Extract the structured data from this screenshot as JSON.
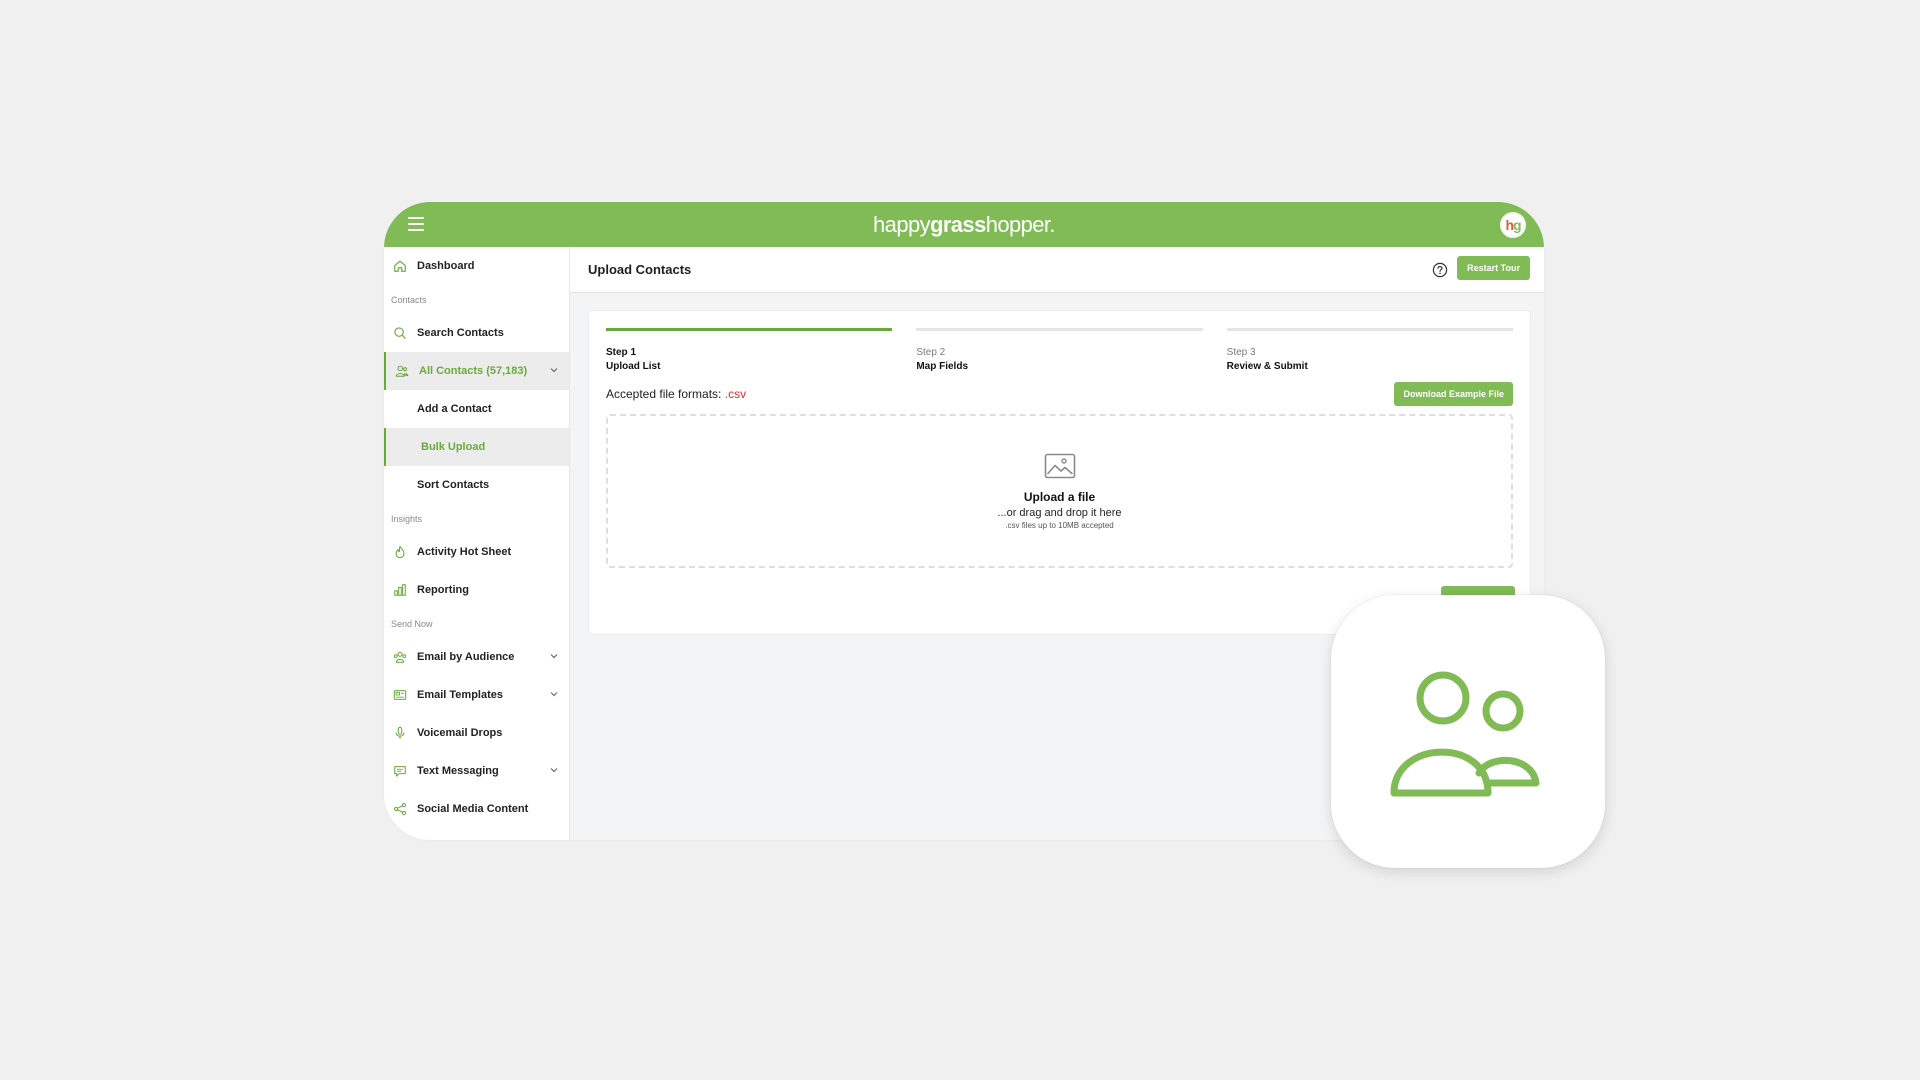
{
  "header": {
    "logo_prefix": "happy",
    "logo_bold": "grass",
    "logo_suffix": "hopper",
    "logo_mark": ".",
    "avatar_h": "h",
    "avatar_g": "g"
  },
  "sidebar": {
    "dashboard": "Dashboard",
    "section_contacts": "Contacts",
    "search_contacts": "Search Contacts",
    "all_contacts": "All Contacts (57,183)",
    "add_contact": "Add a Contact",
    "bulk_upload": "Bulk Upload",
    "sort_contacts": "Sort Contacts",
    "section_insights": "Insights",
    "activity_hot_sheet": "Activity Hot Sheet",
    "reporting": "Reporting",
    "section_send_now": "Send Now",
    "email_by_audience": "Email by Audience",
    "email_templates": "Email Templates",
    "voicemail_drops": "Voicemail Drops",
    "text_messaging": "Text Messaging",
    "social_media_content": "Social Media Content"
  },
  "page": {
    "title": "Upload Contacts",
    "restart_tour": "Restart Tour"
  },
  "steps": [
    {
      "num": "Step 1",
      "label": "Upload List"
    },
    {
      "num": "Step 2",
      "label": "Map Fields"
    },
    {
      "num": "Step 3",
      "label": "Review & Submit"
    }
  ],
  "upload": {
    "formats_label": "Accepted file formats:",
    "formats_ext": ".csv",
    "download_example": "Download Example File",
    "title": "Upload a file",
    "drag_text": "...or drag and drop it here",
    "hint": ".csv files up to 10MB accepted"
  },
  "colors": {
    "brand_green": "#81bb56",
    "active_green": "#6aaa3c",
    "csv_red": "#d32f2f"
  },
  "icons": [
    "hamburger-icon",
    "home-icon",
    "search-icon",
    "users-icon",
    "chevron-down-icon",
    "fire-icon",
    "bar-chart-icon",
    "email-audience-icon",
    "email-template-icon",
    "microphone-icon",
    "chat-icon",
    "share-icon",
    "help-icon",
    "image-icon",
    "contacts-app-icon"
  ]
}
